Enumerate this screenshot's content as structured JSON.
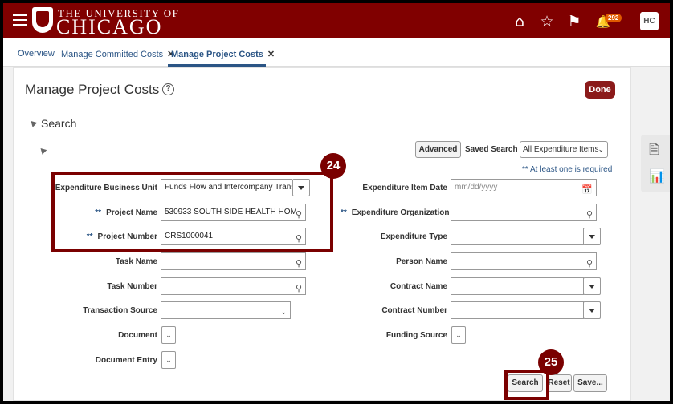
{
  "header": {
    "logo_top": "THE UNIVERSITY OF",
    "logo_big": "CHICAGO",
    "icons": {
      "home": "⌂",
      "star": "☆",
      "flag": "⚑",
      "bell": "🔔"
    },
    "notif_count": "292",
    "avatar": "HC"
  },
  "tabs": [
    {
      "label": "Overview"
    },
    {
      "label": "Manage Committed Costs",
      "close": "✕"
    },
    {
      "label": "Manage Project Costs",
      "close": "✕"
    }
  ],
  "page": {
    "title": "Manage Project Costs",
    "help": "?",
    "done": "Done"
  },
  "search": {
    "header": "Search",
    "advanced": "Advanced",
    "saved_search_label": "Saved Search",
    "saved_search_value": "All Expenditure Items",
    "required_note": "** At least one is required",
    "left": {
      "business_unit_label": "Expenditure Business Unit",
      "business_unit_value": "Funds Flow and Intercompany Trans",
      "project_name_label": "Project Name",
      "project_name_value": "530933 SOUTH SIDE HEALTH HOM",
      "project_number_label": "Project Number",
      "project_number_value": "CRS1000041",
      "task_name_label": "Task Name",
      "task_number_label": "Task Number",
      "transaction_source_label": "Transaction Source",
      "document_label": "Document",
      "document_entry_label": "Document Entry"
    },
    "right": {
      "item_date_label": "Expenditure Item Date",
      "item_date_placeholder": "mm/dd/yyyy",
      "organization_label": "Expenditure Organization",
      "type_label": "Expenditure Type",
      "person_label": "Person Name",
      "contract_name_label": "Contract Name",
      "contract_number_label": "Contract Number",
      "funding_source_label": "Funding Source"
    },
    "stars": "**",
    "buttons": {
      "search": "Search",
      "reset": "Reset",
      "save": "Save..."
    }
  },
  "callouts": {
    "first": "24",
    "second": "25"
  },
  "colors": {
    "brand": "#800000",
    "callout": "#7a0000",
    "link": "#2b5585"
  }
}
